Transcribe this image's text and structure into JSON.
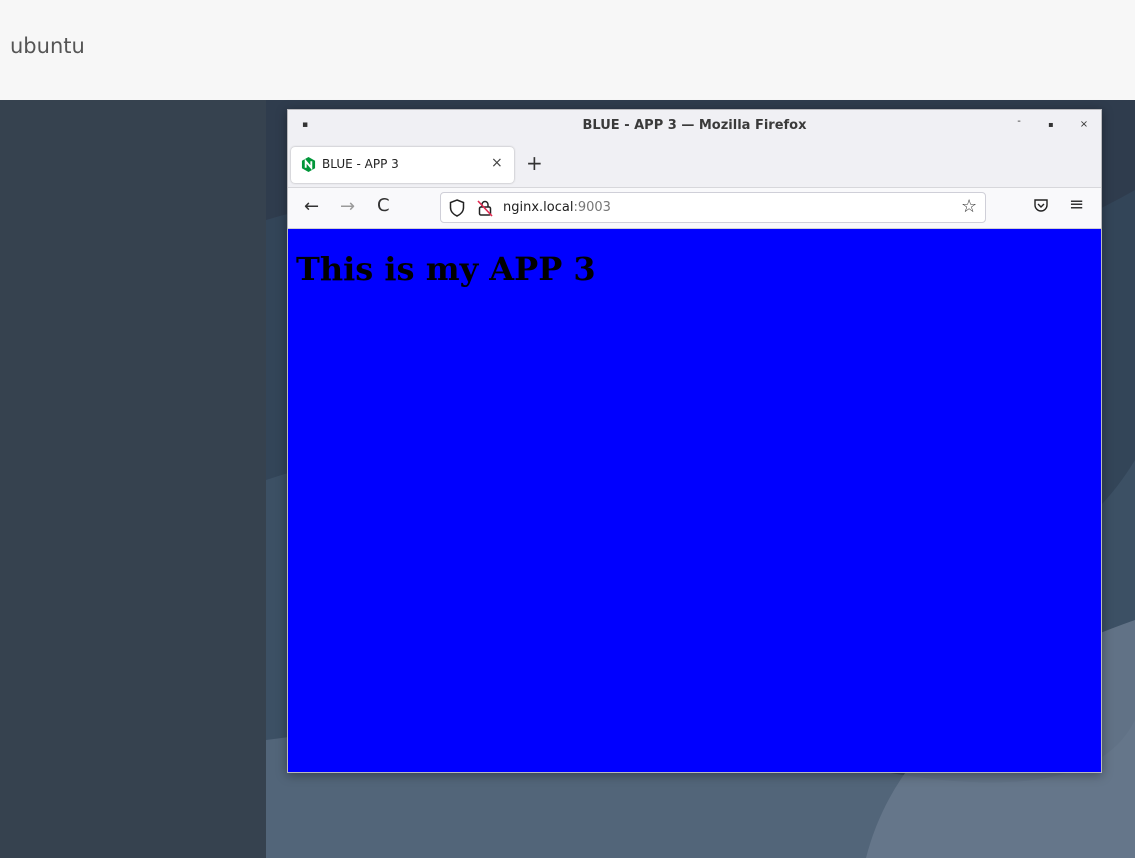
{
  "topbar": {
    "user": "ubuntu"
  },
  "window": {
    "title": "BLUE - APP 3 — Mozilla Firefox",
    "controls": {
      "minimize": "-",
      "maximize": "▪",
      "close": "×"
    }
  },
  "tabs": [
    {
      "label": "BLUE - APP 3",
      "close": "×",
      "favicon": "nginx-favicon"
    }
  ],
  "tabstrip": {
    "new_tab": "+"
  },
  "navbar": {
    "back": "←",
    "forward": "→",
    "reload": "C",
    "url_host": "nginx.local",
    "url_port": ":9003",
    "star": "☆",
    "menu": "≡"
  },
  "page": {
    "heading": "This is my APP 3",
    "background": "#0000ff"
  }
}
